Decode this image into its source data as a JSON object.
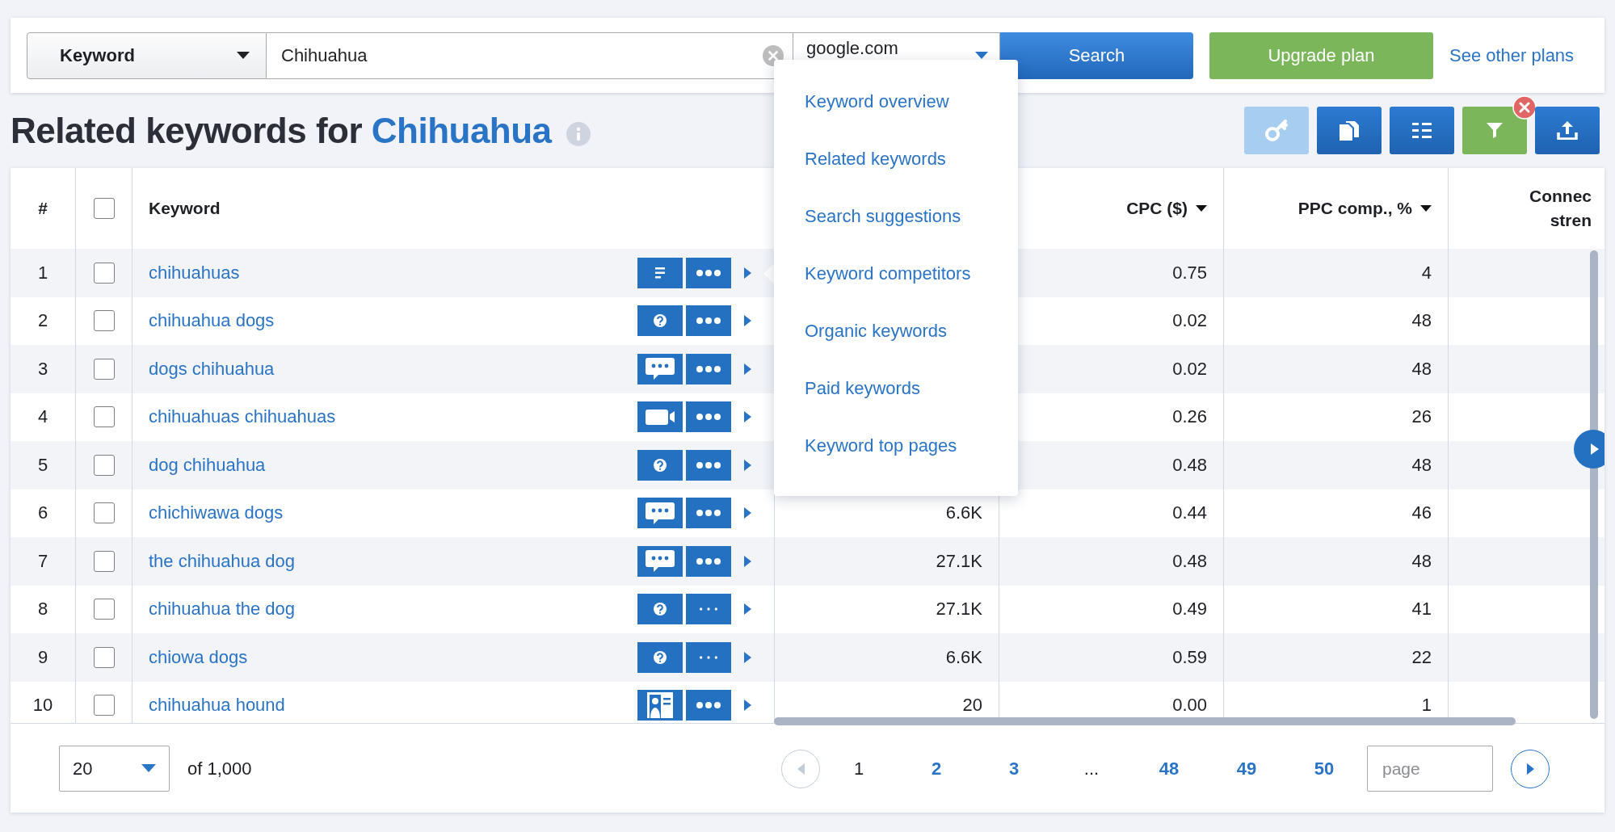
{
  "search_bar": {
    "mode_select": "Keyword",
    "query": "Chihuahua",
    "engine_select": "google.com",
    "search_button": "Search",
    "upgrade_button": "Upgrade plan",
    "plans_link": "See other plans"
  },
  "heading": {
    "prefix": "Related keywords for",
    "keyword": "Chihuahua"
  },
  "toolbar": [
    {
      "kind": "key",
      "disabled": true,
      "badge": false
    },
    {
      "kind": "copy",
      "disabled": false,
      "badge": false
    },
    {
      "kind": "columns",
      "disabled": false,
      "badge": false
    },
    {
      "kind": "filter",
      "disabled": false,
      "badge": true
    },
    {
      "kind": "export",
      "disabled": false,
      "badge": false
    }
  ],
  "table": {
    "number_header": "#",
    "select_all": {
      "checked": false
    },
    "keyword_header": "Keyword",
    "cpc_header": "CPC ($)",
    "ppc_header": "PPC comp., %",
    "connection_header_lines": [
      "Connec",
      "stren"
    ],
    "rows": [
      {
        "number": "1",
        "checked": false,
        "keyword": "chihuahuas",
        "kind": "list",
        "more_faded": false,
        "cpc": "0.75",
        "ppc": "4"
      },
      {
        "number": "2",
        "checked": false,
        "keyword": "chihuahua dogs",
        "kind": "question",
        "more_faded": false,
        "cpc": "0.02",
        "ppc": "48"
      },
      {
        "number": "3",
        "checked": false,
        "keyword": "dogs chihuahua",
        "kind": "chat",
        "more_faded": false,
        "cpc": "0.02",
        "ppc": "48"
      },
      {
        "number": "4",
        "checked": false,
        "keyword": "chihuahuas chihuahuas",
        "kind": "video",
        "more_faded": false,
        "cpc": "0.26",
        "ppc": "26"
      },
      {
        "number": "5",
        "checked": false,
        "keyword": "dog chihuahua",
        "kind": "question",
        "more_faded": false,
        "cpc": "0.48",
        "ppc": "48"
      },
      {
        "number": "6",
        "checked": false,
        "keyword": "chichiwawa dogs",
        "kind": "chat",
        "more_faded": false,
        "volume": "6.6K",
        "cpc": "0.44",
        "ppc": "46"
      },
      {
        "number": "7",
        "checked": false,
        "keyword": "the chihuahua dog",
        "kind": "chat",
        "more_faded": false,
        "volume": "27.1K",
        "cpc": "0.48",
        "ppc": "48"
      },
      {
        "number": "8",
        "checked": false,
        "keyword": "chihuahua the dog",
        "kind": "question",
        "more_faded": true,
        "volume": "27.1K",
        "cpc": "0.49",
        "ppc": "41"
      },
      {
        "number": "9",
        "checked": false,
        "keyword": "chiowa dogs",
        "kind": "question",
        "more_faded": true,
        "volume": "6.6K",
        "cpc": "0.59",
        "ppc": "22"
      },
      {
        "number": "10",
        "checked": false,
        "keyword": "chihuahua hound",
        "kind": "contact",
        "more_faded": false,
        "volume": "20",
        "cpc": "0.00",
        "ppc": "1"
      }
    ]
  },
  "menu": {
    "items": [
      "Keyword overview",
      "Related keywords",
      "Search suggestions",
      "Keyword competitors",
      "Organic keywords",
      "Paid keywords",
      "Keyword top pages"
    ]
  },
  "footer": {
    "per_page": "20",
    "total": "of 1,000",
    "prev_disabled": true,
    "next_disabled": false,
    "page_placeholder": "page",
    "pages": [
      {
        "label": "1",
        "kind": "page",
        "selected": true
      },
      {
        "label": "2",
        "kind": "page",
        "selected": false
      },
      {
        "label": "3",
        "kind": "page",
        "selected": false
      },
      {
        "label": "...",
        "kind": "gap"
      },
      {
        "label": "48",
        "kind": "page",
        "selected": false
      },
      {
        "label": "49",
        "kind": "page",
        "selected": false
      },
      {
        "label": "50",
        "kind": "page",
        "selected": false
      }
    ]
  }
}
